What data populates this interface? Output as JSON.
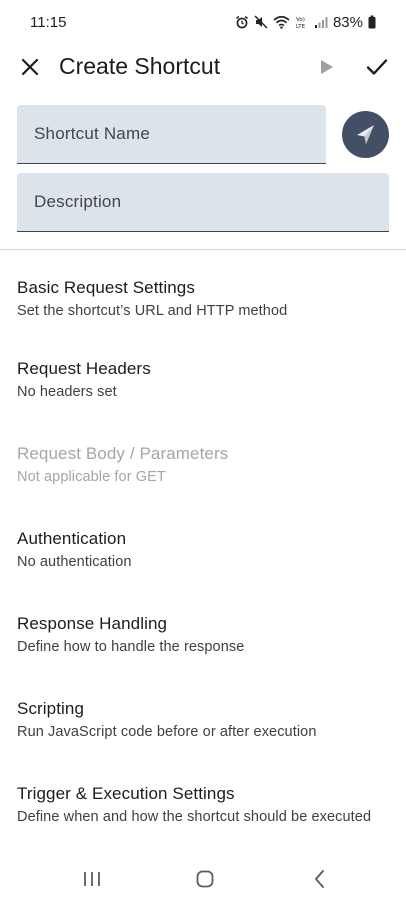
{
  "status_bar": {
    "time": "11:15",
    "battery": "83%"
  },
  "app_bar": {
    "title": "Create Shortcut"
  },
  "form": {
    "name_placeholder": "Shortcut Name",
    "description_placeholder": "Description"
  },
  "settings": [
    {
      "title": "Basic Request Settings",
      "subtitle": "Set the shortcut’s URL and HTTP method",
      "enabled": true
    },
    {
      "title": "Request Headers",
      "subtitle": "No headers set",
      "enabled": true
    },
    {
      "title": "Request Body / Parameters",
      "subtitle": "Not applicable for GET",
      "enabled": false
    },
    {
      "title": "Authentication",
      "subtitle": "No authentication",
      "enabled": true
    },
    {
      "title": "Response Handling",
      "subtitle": "Define how to handle the response",
      "enabled": true
    },
    {
      "title": "Scripting",
      "subtitle": "Run JavaScript code before or after execution",
      "enabled": true
    },
    {
      "title": "Trigger & Execution Settings",
      "subtitle": "Define when and how the shortcut should be executed",
      "enabled": true
    }
  ],
  "icons": {
    "close": "close-icon",
    "play": "play-icon",
    "check": "check-icon",
    "shortcut_icon": "send-arrow-icon",
    "nav_recents": "recents-icon",
    "nav_home": "home-icon",
    "nav_back": "back-icon"
  },
  "colors": {
    "field_background": "#dde3ea",
    "icon_button_background": "#434f64",
    "disabled_text": "#a4a6aa"
  }
}
